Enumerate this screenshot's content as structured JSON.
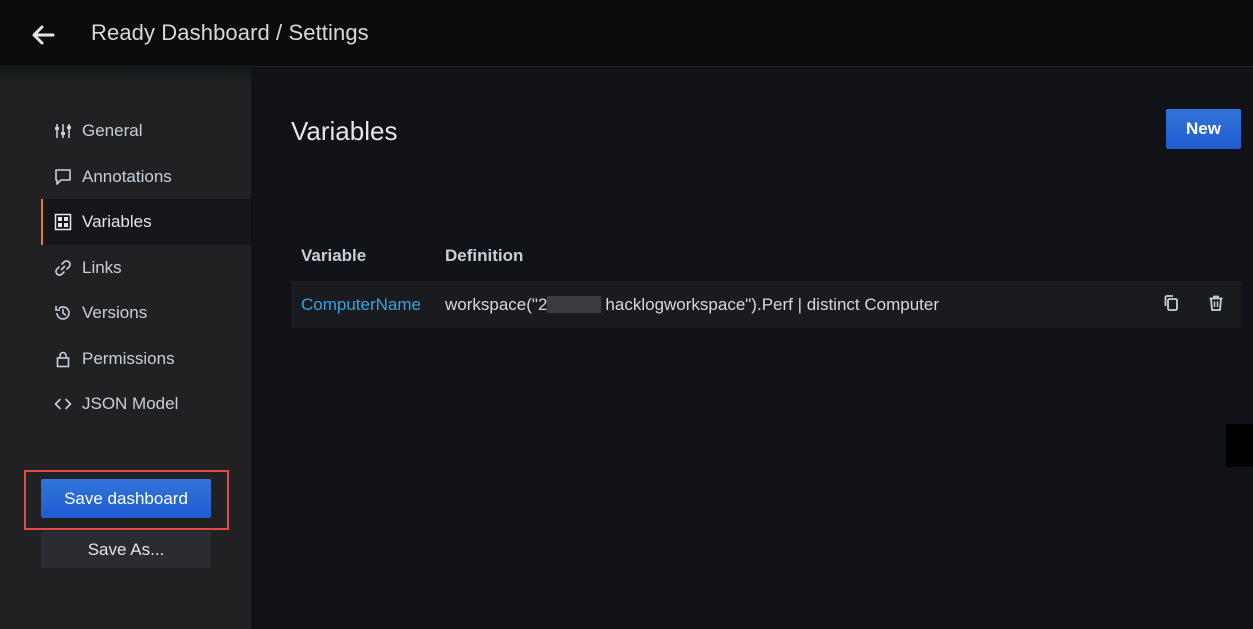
{
  "header": {
    "title": "Ready Dashboard / Settings",
    "back_icon": "arrow-left-icon"
  },
  "sidebar": {
    "items": [
      {
        "label": "General",
        "icon": "sliders-icon",
        "active": false
      },
      {
        "label": "Annotations",
        "icon": "comment-icon",
        "active": false
      },
      {
        "label": "Variables",
        "icon": "calculator-icon",
        "active": true
      },
      {
        "label": "Links",
        "icon": "link-icon",
        "active": false
      },
      {
        "label": "Versions",
        "icon": "history-icon",
        "active": false
      },
      {
        "label": "Permissions",
        "icon": "lock-icon",
        "active": false
      },
      {
        "label": "JSON Model",
        "icon": "code-icon",
        "active": false
      }
    ],
    "save_label": "Save dashboard",
    "save_as_label": "Save As..."
  },
  "main": {
    "heading": "Variables",
    "new_label": "New",
    "table": {
      "headers": [
        "Variable",
        "Definition"
      ],
      "rows": [
        {
          "name": "ComputerName",
          "definition_prefix": "workspace(\"2",
          "definition_suffix": "hacklogworkspace\").Perf | distinct Computer"
        }
      ]
    }
  },
  "colors": {
    "accent_blue": "#3274d9",
    "link_blue": "#33a2e5",
    "active_indicator": "#eb7b18",
    "highlight_box": "#e34b4b"
  }
}
